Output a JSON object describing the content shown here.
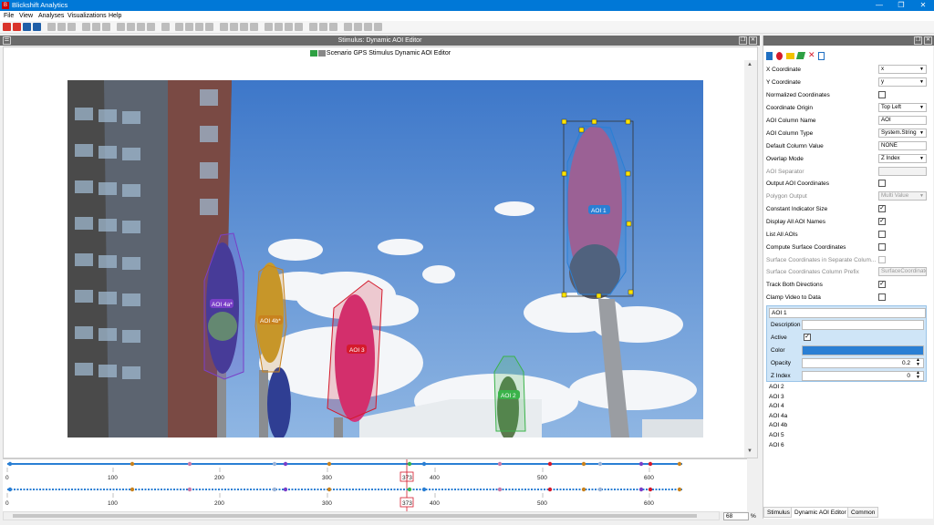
{
  "window": {
    "title": "Blickshift Analytics"
  },
  "menu": [
    "File",
    "View",
    "Analyses",
    "Visualizations",
    "Help"
  ],
  "docked_title": "Stimulus: Dynamic AOI Editor",
  "editor_header": "Scenario GPS Stimulus Dynamic AOI Editor",
  "aois": [
    {
      "name": "AOI 1",
      "color": "#2a7fd4"
    },
    {
      "name": "AOI 4a*",
      "color": "#7a3fc8"
    },
    {
      "name": "AOI 4b*",
      "color": "#c8821e"
    },
    {
      "name": "AOI 3",
      "color": "#d41a2c"
    },
    {
      "name": "AOI 2",
      "color": "#3ab34a"
    }
  ],
  "timeline": {
    "ticks": [
      "0",
      "100",
      "200",
      "300",
      "400",
      "500",
      "600"
    ],
    "current_frame": "373"
  },
  "zoom": "68",
  "zoom_unit": "%",
  "properties": [
    {
      "label": "X Coordinate",
      "type": "dropdown",
      "value": "x"
    },
    {
      "label": "Y Coordinate",
      "type": "dropdown",
      "value": "y"
    },
    {
      "label": "Normalized Coordinates",
      "type": "check",
      "checked": false
    },
    {
      "label": "Coordinate Origin",
      "type": "dropdown",
      "value": "Top Left"
    },
    {
      "label": "AOI Column Name",
      "type": "text",
      "value": "AOI"
    },
    {
      "label": "AOI Column Type",
      "type": "dropdown",
      "value": "System.String"
    },
    {
      "label": "Default Column Value",
      "type": "text",
      "value": "NONE"
    },
    {
      "label": "Overlap Mode",
      "type": "dropdown",
      "value": "Z Index"
    },
    {
      "label": "AOI Separator",
      "type": "text",
      "value": "",
      "disabled": true
    },
    {
      "label": "Output AOI Coordinates",
      "type": "check",
      "checked": false
    },
    {
      "label": "Polygon Output",
      "type": "text",
      "value": "Multi Value",
      "disabled": true
    },
    {
      "label": "Constant Indicator Size",
      "type": "check",
      "checked": true
    },
    {
      "label": "Display All AOI Names",
      "type": "check",
      "checked": true
    },
    {
      "label": "List All AOIs",
      "type": "check",
      "checked": false
    },
    {
      "label": "Compute Surface Coordinates",
      "type": "check",
      "checked": false
    },
    {
      "label": "Surface Coordinates in Separate Colum...",
      "type": "check",
      "checked": false,
      "disabled": true
    },
    {
      "label": "Surface Coordinates Column Prefix",
      "type": "text",
      "value": "SurfaceCoordinate",
      "disabled": true
    },
    {
      "label": "Track Both Directions",
      "type": "check",
      "checked": true
    },
    {
      "label": "Clamp Video to Data",
      "type": "check",
      "checked": false
    }
  ],
  "aoi_editor": {
    "name": "AOI 1",
    "description_label": "Description",
    "description": "",
    "active_label": "Active",
    "active": true,
    "color_label": "Color",
    "color": "#2a7fd4",
    "opacity_label": "Opacity",
    "opacity": "0.2",
    "zindex_label": "Z Index",
    "zindex": "0"
  },
  "aoi_list": [
    "AOI 2",
    "AOI 3",
    "AOI 4",
    "AOI 4a",
    "AOI 4b",
    "AOI 5",
    "AOI 6"
  ],
  "panel_tabs": [
    "Stimulus",
    "Dynamic AOI Editor",
    "Common"
  ]
}
